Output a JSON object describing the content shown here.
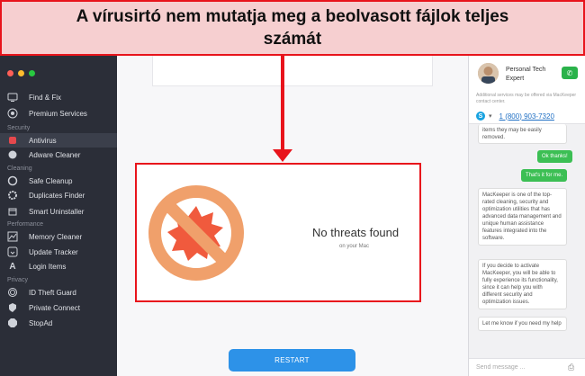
{
  "banner": {
    "text": "A vírusirtó nem mutatja meg a beolvasott fájlok teljes számát"
  },
  "sidebar": {
    "items": [
      {
        "label": "Find & Fix",
        "icon": "monitor-icon"
      },
      {
        "label": "Premium Services",
        "icon": "headset-icon"
      },
      {
        "label": "Antivirus",
        "icon": "shield-icon",
        "active": true
      },
      {
        "label": "Adware Cleaner",
        "icon": "hand-icon"
      },
      {
        "label": "Safe Cleanup",
        "icon": "broom-icon"
      },
      {
        "label": "Duplicates Finder",
        "icon": "gear-icon"
      },
      {
        "label": "Smart Uninstaller",
        "icon": "box-icon"
      },
      {
        "label": "Memory Cleaner",
        "icon": "chart-icon"
      },
      {
        "label": "Update Tracker",
        "icon": "arrow-icon"
      },
      {
        "label": "Login Items",
        "icon": "font-icon"
      },
      {
        "label": "ID Theft Guard",
        "icon": "fingerprint-icon"
      },
      {
        "label": "Private Connect",
        "icon": "lock-icon"
      },
      {
        "label": "StopAd",
        "icon": "stop-icon"
      }
    ],
    "sections": [
      "Security",
      "Cleaning",
      "Performance",
      "Privacy"
    ]
  },
  "main": {
    "status_title": "No threats found",
    "status_sub": "on your Mac",
    "restart_label": "RESTART"
  },
  "chat": {
    "expert_title": "Personal Tech Expert",
    "additional": "Additional services may be offered via MacKeeper contact center.",
    "phone": "1 (800) 903-7320",
    "partial_msg": "items they may be easily removed.",
    "user_msg_1": "Ok thanks!",
    "user_msg_2": "That's it for me.",
    "agent_msg_1": "MacKeeper is one of the top-rated cleaning, security and optimization utilities that has advanced data management and unique human assistance features integrated into the software.",
    "agent_msg_2": "If you decide to activate MacKeeper, you will be able to fully experience its functionality, since it can help you with different security and optimization issues.",
    "agent_msg_3": "Let me know if you need my help",
    "input_placeholder": "Send message ..."
  },
  "colors": {
    "accent_red": "#e8141c",
    "restart_blue": "#2d92e8",
    "chat_green": "#3cbf54",
    "sidebar_bg": "#2b2e38"
  }
}
